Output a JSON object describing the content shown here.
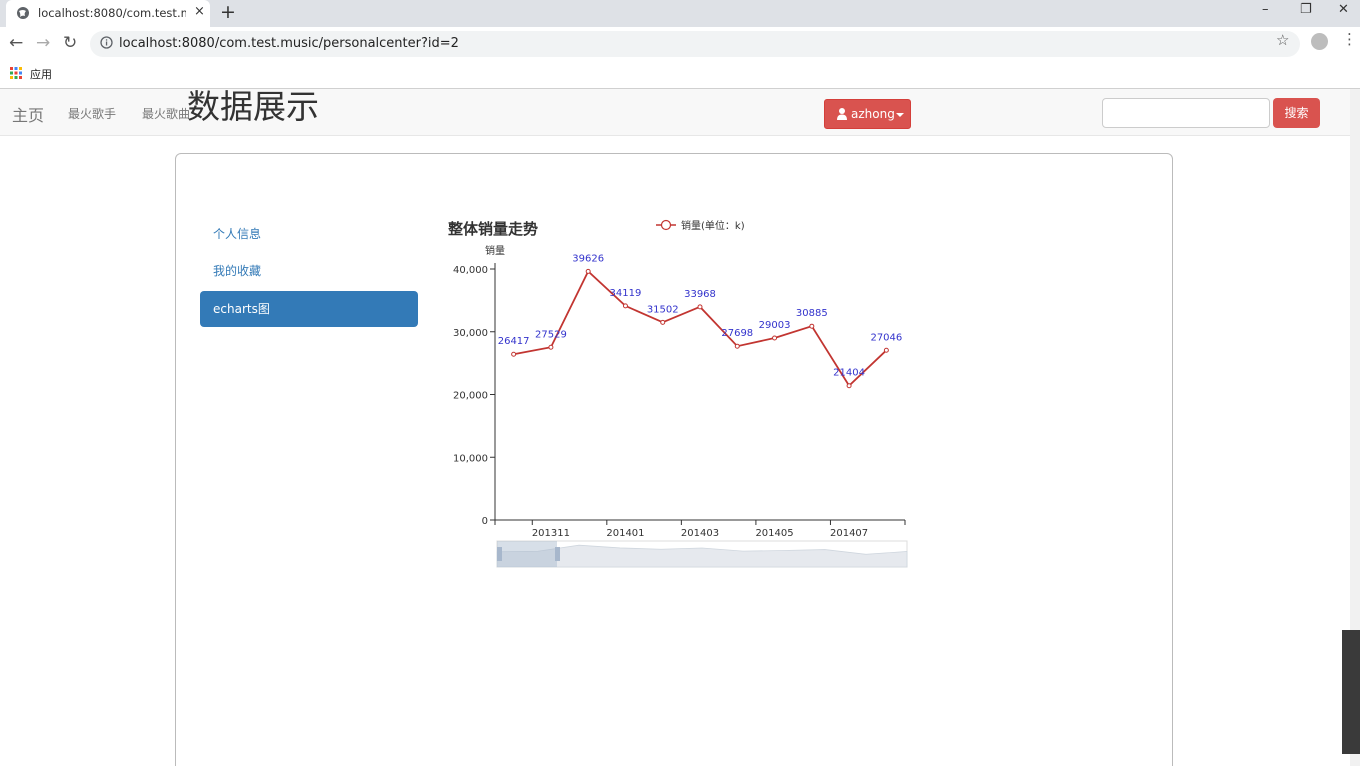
{
  "browser": {
    "tab_title": "localhost:8080/com.test.music",
    "tab_close": "×",
    "new_tab": "+",
    "url": "localhost:8080/com.test.music/personalcenter?id=2",
    "bookmark_apps": "应用",
    "window_minimize": "–",
    "window_restore": "❐",
    "window_close": "✕"
  },
  "navbar": {
    "brand": "主页",
    "links": [
      "最火歌手",
      "最火歌曲"
    ],
    "user_label": "azhong",
    "search_placeholder": "",
    "search_button": "搜索"
  },
  "page": {
    "title": "数据展示",
    "sidebar": [
      {
        "label": "个人信息",
        "active": false
      },
      {
        "label": "我的收藏",
        "active": false
      },
      {
        "label": "echarts图",
        "active": true
      }
    ]
  },
  "colors": {
    "primary": "#337ab7",
    "danger": "#d9534f",
    "series_line": "#c23531",
    "data_label": "#3333cc"
  },
  "chart_data": {
    "type": "line",
    "title": "整体销量走势",
    "ylabel": "销量",
    "legend": [
      "销量(单位：k)"
    ],
    "legend_position": "top",
    "ylim": [
      0,
      40000
    ],
    "y_ticks": [
      "40,000",
      "30,000",
      "20,000",
      "10,000",
      "0"
    ],
    "x_tick_labels": [
      "201311",
      "201401",
      "201403",
      "201405",
      "201407"
    ],
    "series": [
      {
        "name": "销量(单位：k)",
        "values": [
          26417,
          27529,
          39626,
          34119,
          31502,
          33968,
          27698,
          29003,
          30885,
          21404,
          27046
        ]
      }
    ],
    "data_zoom": true,
    "grid": false
  }
}
